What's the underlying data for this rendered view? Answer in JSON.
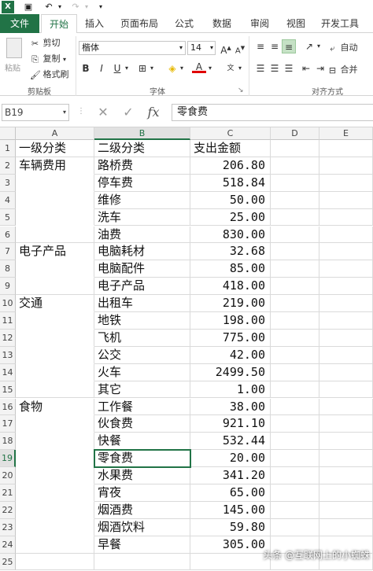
{
  "ribbon_tabs": [
    "文件",
    "开始",
    "插入",
    "页面布局",
    "公式",
    "数据",
    "审阅",
    "视图",
    "开发工具"
  ],
  "clipboard": {
    "paste": "粘贴",
    "cut": "剪切",
    "copy": "复制",
    "format_painter": "格式刷",
    "group_label": "剪贴板"
  },
  "font": {
    "name": "楷体",
    "size": "14",
    "bold": "B",
    "italic": "I",
    "underline": "U",
    "font_color": "A",
    "group_label": "字体"
  },
  "alignment": {
    "wrap": "自动",
    "merge": "合并",
    "group_label": "对齐方式"
  },
  "formula_bar": {
    "name_box": "B19",
    "fx": "fx",
    "content": "零食费"
  },
  "columns": [
    "A",
    "B",
    "C",
    "D",
    "E"
  ],
  "rows": [
    {
      "num": "1",
      "a": "一级分类",
      "b": "二级分类",
      "c": "支出金额"
    },
    {
      "num": "2",
      "a": "车辆费用",
      "b": "路桥费",
      "c": "206.80"
    },
    {
      "num": "3",
      "a": "",
      "b": "停车费",
      "c": "518.84"
    },
    {
      "num": "4",
      "a": "",
      "b": "维修",
      "c": "50.00"
    },
    {
      "num": "5",
      "a": "",
      "b": "洗车",
      "c": "25.00"
    },
    {
      "num": "6",
      "a": "",
      "b": "油费",
      "c": "830.00"
    },
    {
      "num": "7",
      "a": "电子产品",
      "b": "电脑耗材",
      "c": "32.68"
    },
    {
      "num": "8",
      "a": "",
      "b": "电脑配件",
      "c": "85.00"
    },
    {
      "num": "9",
      "a": "",
      "b": "电子产品",
      "c": "418.00"
    },
    {
      "num": "10",
      "a": "交通",
      "b": "出租车",
      "c": "219.00"
    },
    {
      "num": "11",
      "a": "",
      "b": "地铁",
      "c": "198.00"
    },
    {
      "num": "12",
      "a": "",
      "b": "飞机",
      "c": "775.00"
    },
    {
      "num": "13",
      "a": "",
      "b": "公交",
      "c": "42.00"
    },
    {
      "num": "14",
      "a": "",
      "b": "火车",
      "c": "2499.50"
    },
    {
      "num": "15",
      "a": "",
      "b": "其它",
      "c": "1.00"
    },
    {
      "num": "16",
      "a": "食物",
      "b": "工作餐",
      "c": "38.00"
    },
    {
      "num": "17",
      "a": "",
      "b": "伙食费",
      "c": "921.10"
    },
    {
      "num": "18",
      "a": "",
      "b": "快餐",
      "c": "532.44"
    },
    {
      "num": "19",
      "a": "",
      "b": "零食费",
      "c": "20.00"
    },
    {
      "num": "20",
      "a": "",
      "b": "水果费",
      "c": "341.20"
    },
    {
      "num": "21",
      "a": "",
      "b": "宵夜",
      "c": "65.00"
    },
    {
      "num": "22",
      "a": "",
      "b": "烟酒费",
      "c": "145.00"
    },
    {
      "num": "23",
      "a": "",
      "b": "烟酒饮料",
      "c": "59.80"
    },
    {
      "num": "24",
      "a": "",
      "b": "早餐",
      "c": "305.00"
    },
    {
      "num": "25",
      "a": "",
      "b": "",
      "c": ""
    }
  ],
  "watermark": "头条 @互联网上的小蜘蛛",
  "colors": {
    "excel_green": "#217346"
  }
}
